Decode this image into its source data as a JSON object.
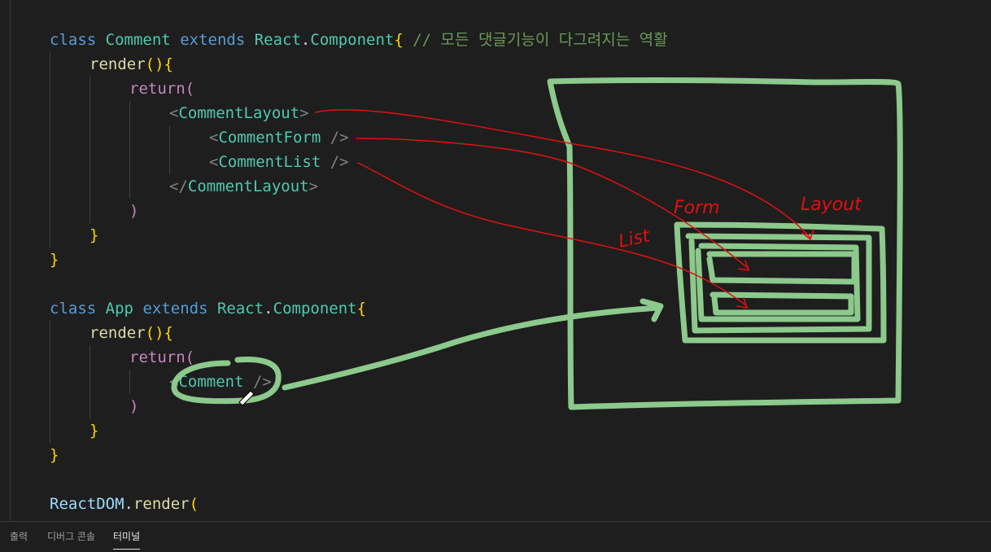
{
  "code": {
    "comment_class": {
      "kw_class": "class",
      "name": "Comment",
      "kw_extends": "extends",
      "base_ns": "React",
      "dot": ".",
      "base_cls": "Component",
      "brace": "{",
      "comment": "// 모든 댓글기능이 다그려지는 역활"
    },
    "render1": {
      "name": "render",
      "parens": "(){"
    },
    "return1": {
      "kw": "return",
      "paren": "("
    },
    "layout_open": {
      "lt": "<",
      "tag": "CommentLayout",
      "gt": ">"
    },
    "form_tag": {
      "lt": "<",
      "tag": "CommentForm",
      "end": " />"
    },
    "list_tag": {
      "lt": "<",
      "tag": "CommentList",
      "end": " />"
    },
    "layout_close": {
      "lt": "</",
      "tag": "CommentLayout",
      "gt": ">"
    },
    "close_paren1": ")",
    "close_brace1": "}",
    "close_brace2": "}",
    "app_class": {
      "kw_class": "class",
      "name": "App",
      "kw_extends": "extends",
      "base_ns": "React",
      "dot": ".",
      "base_cls": "Component",
      "brace": "{"
    },
    "render2": {
      "name": "render",
      "parens": "(){"
    },
    "return2": {
      "kw": "return",
      "paren": "("
    },
    "comment_tag": {
      "lt": "<",
      "tag": "Comment",
      "end": " />"
    },
    "close_paren2": ")",
    "close_brace3": "}",
    "close_brace4": "}",
    "reactdom": {
      "obj": "ReactDOM",
      "dot": ".",
      "method": "render",
      "paren": "("
    }
  },
  "annotations": {
    "form_label": "Form",
    "layout_label": "Layout",
    "list_label": "List"
  },
  "panel": {
    "tabs": [
      {
        "label": "출력",
        "active": false
      },
      {
        "label": "디버그 콘솔",
        "active": false
      },
      {
        "label": "터미널",
        "active": true
      }
    ]
  },
  "colors": {
    "background": "#1e1e1e",
    "keyword": "#569cd6",
    "class_name": "#4ec9b0",
    "function": "#dcdcaa",
    "control": "#c586c0",
    "comment": "#6a9955",
    "annotation_green": "#8cc98c",
    "annotation_red": "#e01010"
  }
}
